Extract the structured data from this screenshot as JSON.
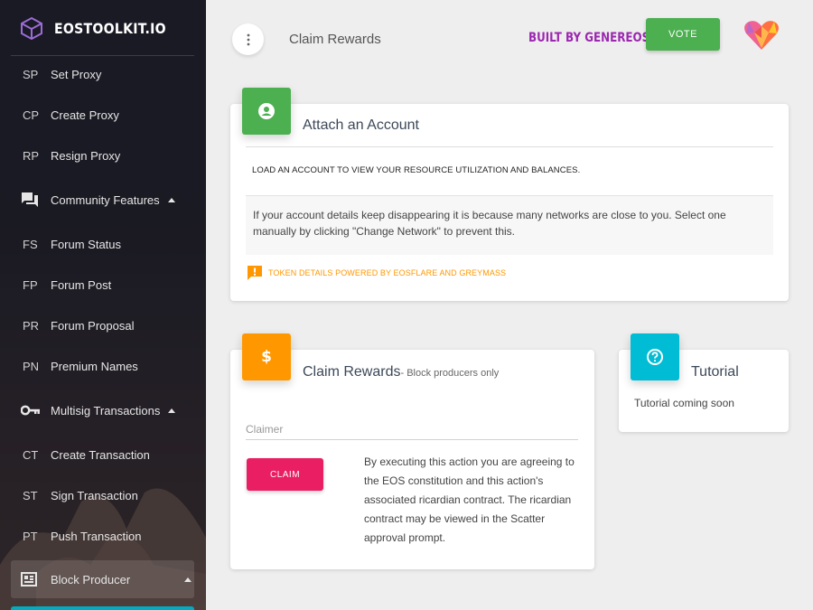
{
  "sidebar": {
    "brand": "EOSTOOLKIT.IO",
    "items": [
      {
        "abbr": "SP",
        "label": "Set Proxy"
      },
      {
        "abbr": "CP",
        "label": "Create Proxy"
      },
      {
        "abbr": "RP",
        "label": "Resign Proxy"
      },
      {
        "icon": "forum-icon",
        "label": "Community Features",
        "expanded": true
      },
      {
        "abbr": "FS",
        "label": "Forum Status"
      },
      {
        "abbr": "FP",
        "label": "Forum Post"
      },
      {
        "abbr": "PR",
        "label": "Forum Proposal"
      },
      {
        "abbr": "PN",
        "label": "Premium Names"
      },
      {
        "icon": "key-icon",
        "label": "Multisig Transactions",
        "expanded": true
      },
      {
        "abbr": "CT",
        "label": "Create Transaction"
      },
      {
        "abbr": "ST",
        "label": "Sign Transaction"
      },
      {
        "abbr": "PT",
        "label": "Push Transaction"
      },
      {
        "icon": "block-producer-icon",
        "label": "Block Producer",
        "expanded": true,
        "active": true
      }
    ]
  },
  "header": {
    "title": "Claim Rewards",
    "built_by": "BUILT BY GENEREOS",
    "vote_label": "VOTE"
  },
  "attach_card": {
    "icon": "account-circle-icon",
    "title": "Attach an Account",
    "instruction": "LOAD AN ACCOUNT TO VIEW YOUR RESOURCE UTILIZATION AND BALANCES.",
    "note": "If your account details keep disappearing it is because many networks are close to you. Select one manually by clicking \"Change Network\" to prevent this.",
    "powered_by": "TOKEN DETAILS POWERED BY EOSFLARE AND GREYMASS"
  },
  "claim_card": {
    "icon": "dollar-icon",
    "title": "Claim Rewards",
    "subtitle": "- Block producers only",
    "claimer_placeholder": "Claimer",
    "claimer_value": "",
    "button_label": "CLAIM",
    "disclaimer": "By executing this action you are agreeing to the EOS constitution and this action's associated ricardian contract. The ricardian contract may be viewed in the Scatter approval prompt."
  },
  "tutorial_card": {
    "icon": "help-icon",
    "title": "Tutorial",
    "body": "Tutorial coming soon"
  },
  "colors": {
    "green": "#4caf50",
    "orange": "#ff9800",
    "cyan": "#00bcd4",
    "pink": "#e91e63",
    "purple": "#9c27b0"
  }
}
